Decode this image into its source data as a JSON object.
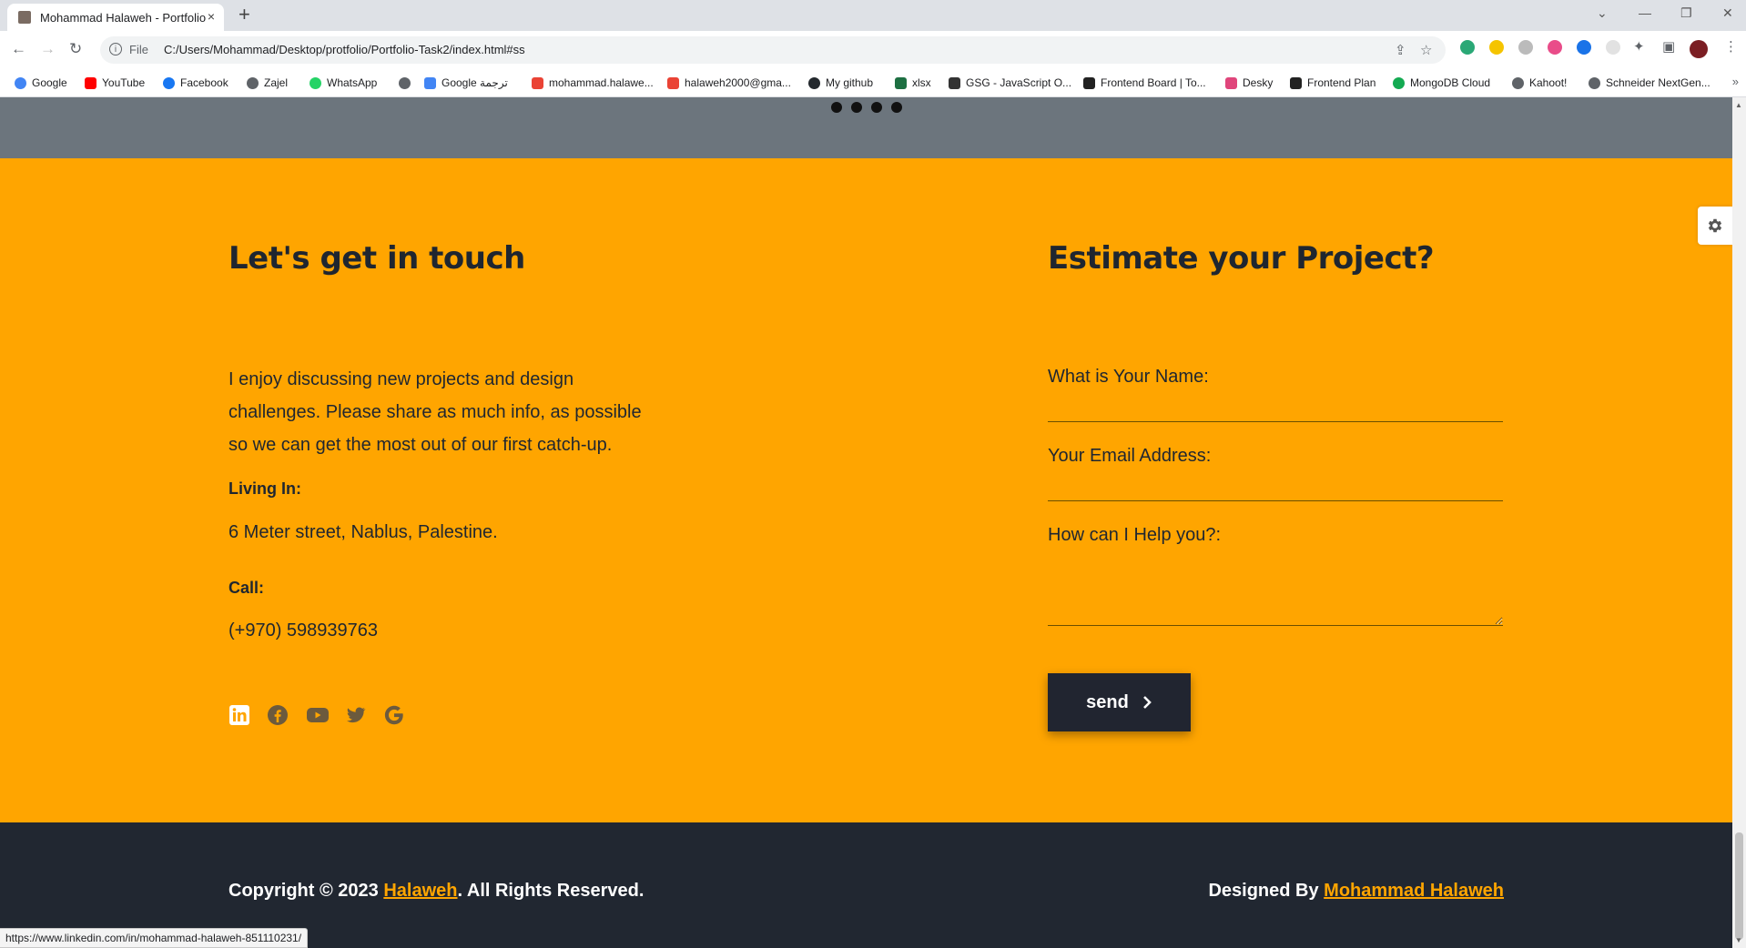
{
  "browser": {
    "tab_title": "Mohammad Halaweh - Portfolio",
    "new_tab": "+",
    "close": "×",
    "url_scheme": "File",
    "url": "C:/Users/Mohammad/Desktop/protfolio/Portfolio-Task2/index.html#ss",
    "bookmarks": [
      {
        "label": "Google",
        "icon": "google-icon",
        "color": "#4285f4"
      },
      {
        "label": "YouTube",
        "icon": "youtube-icon",
        "color": "#ff0000"
      },
      {
        "label": "Facebook",
        "icon": "facebook-icon",
        "color": "#1877f2"
      },
      {
        "label": "Zajel",
        "icon": "globe-icon",
        "color": "#5f6368"
      },
      {
        "label": "WhatsApp",
        "icon": "whatsapp-icon",
        "color": "#25d366"
      },
      {
        "label": "",
        "icon": "globe-icon",
        "color": "#5f6368"
      },
      {
        "label": "Google ترجمة",
        "icon": "translate-icon",
        "color": "#4285f4"
      },
      {
        "label": "mohammad.halawe...",
        "icon": "gmail-icon",
        "color": "#ea4335"
      },
      {
        "label": "halaweh2000@gma...",
        "icon": "gmail-icon",
        "color": "#ea4335"
      },
      {
        "label": "My github",
        "icon": "github-icon",
        "color": "#24292e"
      },
      {
        "label": "xlsx",
        "icon": "excel-icon",
        "color": "#1d6f42"
      },
      {
        "label": "GSG - JavaScript O...",
        "icon": "document-icon",
        "color": "#333333"
      },
      {
        "label": "Frontend Board | To...",
        "icon": "notion-icon",
        "color": "#222222"
      },
      {
        "label": "Desky",
        "icon": "desky-icon",
        "color": "#e0457b"
      },
      {
        "label": "Frontend Plan",
        "icon": "notion-icon",
        "color": "#222222"
      },
      {
        "label": "MongoDB Cloud",
        "icon": "mongodb-icon",
        "color": "#13aa52"
      },
      {
        "label": "Kahoot!",
        "icon": "globe-icon",
        "color": "#5f6368"
      },
      {
        "label": "Schneider NextGen...",
        "icon": "globe-icon",
        "color": "#5f6368"
      }
    ],
    "bookmarks_more": "»",
    "status_url": "https://www.linkedin.com/in/mohammad-halaweh-851110231/"
  },
  "contact": {
    "heading": "Let's get in touch",
    "intro": "I enjoy discussing new projects and design challenges. Please share as much info, as possible so we can get the most out of our first catch-up.",
    "living_label": "Living In:",
    "living_value": "6 Meter street, Nablus, Palestine.",
    "call_label": "Call:",
    "call_value": "(+970) 598939763",
    "socials": [
      "linkedin-icon",
      "facebook-icon",
      "youtube-icon",
      "twitter-icon",
      "google-icon"
    ]
  },
  "form": {
    "heading": "Estimate your Project?",
    "name_label": "What is Your Name:",
    "email_label": "Your Email Address:",
    "message_label": "How can I Help you?:",
    "send_label": "send"
  },
  "footer": {
    "copyright_prefix": "Copyright © 2023 ",
    "copyright_link": "Halaweh",
    "copyright_suffix": ". All Rights Reserved.",
    "designed_prefix": "Designed By ",
    "designed_link": "Mohammad Halaweh"
  },
  "colors": {
    "accent": "#ffa500",
    "dark": "#212731",
    "band": "#6c757d"
  }
}
